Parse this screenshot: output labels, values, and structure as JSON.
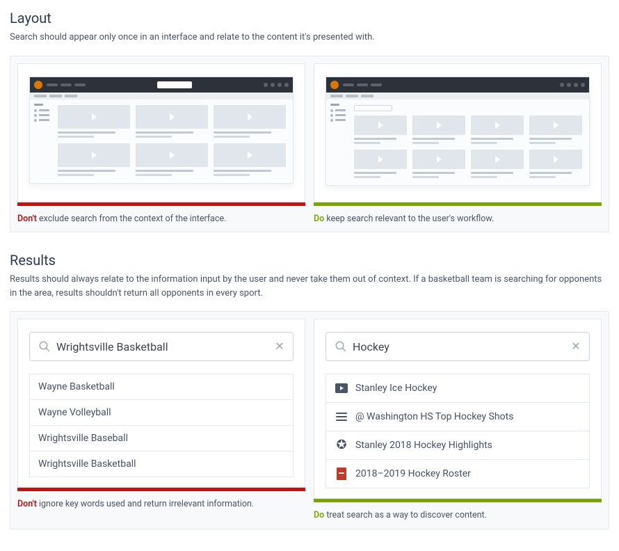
{
  "layout": {
    "heading": "Layout",
    "description": "Search should appear only once in an interface and relate to the content it's presented with.",
    "dont_label": "Don't",
    "dont_caption": " exclude search from the context of the interface.",
    "do_label": "Do",
    "do_caption": " keep search relevant to the user's workflow."
  },
  "results": {
    "heading": "Results",
    "description": "Results should always relate to the information input by the user and never take them out of context. If a basketball team is searching for opponents in the area, results shouldn't return all opponents in every sport.",
    "dont_label": "Don't",
    "dont_caption": " ignore key words used and return irrelevant information.",
    "do_label": "Do",
    "do_caption": " treat search as a way to discover content.",
    "dont_example": {
      "query": "Wrightsville Basketball",
      "items": [
        {
          "label": "Wayne Basketball"
        },
        {
          "label": "Wayne Volleyball"
        },
        {
          "label": "Wrightsville Baseball"
        },
        {
          "label": "Wrightsville Basketball"
        }
      ]
    },
    "do_example": {
      "query": "Hockey",
      "items": [
        {
          "label": "Stanley Ice Hockey",
          "icon": "video"
        },
        {
          "label": "@ Washington HS Top Hockey Shots",
          "icon": "list"
        },
        {
          "label": "Stanley 2018 Hockey Highlights",
          "icon": "star"
        },
        {
          "label": "2018–2019 Hockey Roster",
          "icon": "pdf"
        }
      ]
    }
  }
}
